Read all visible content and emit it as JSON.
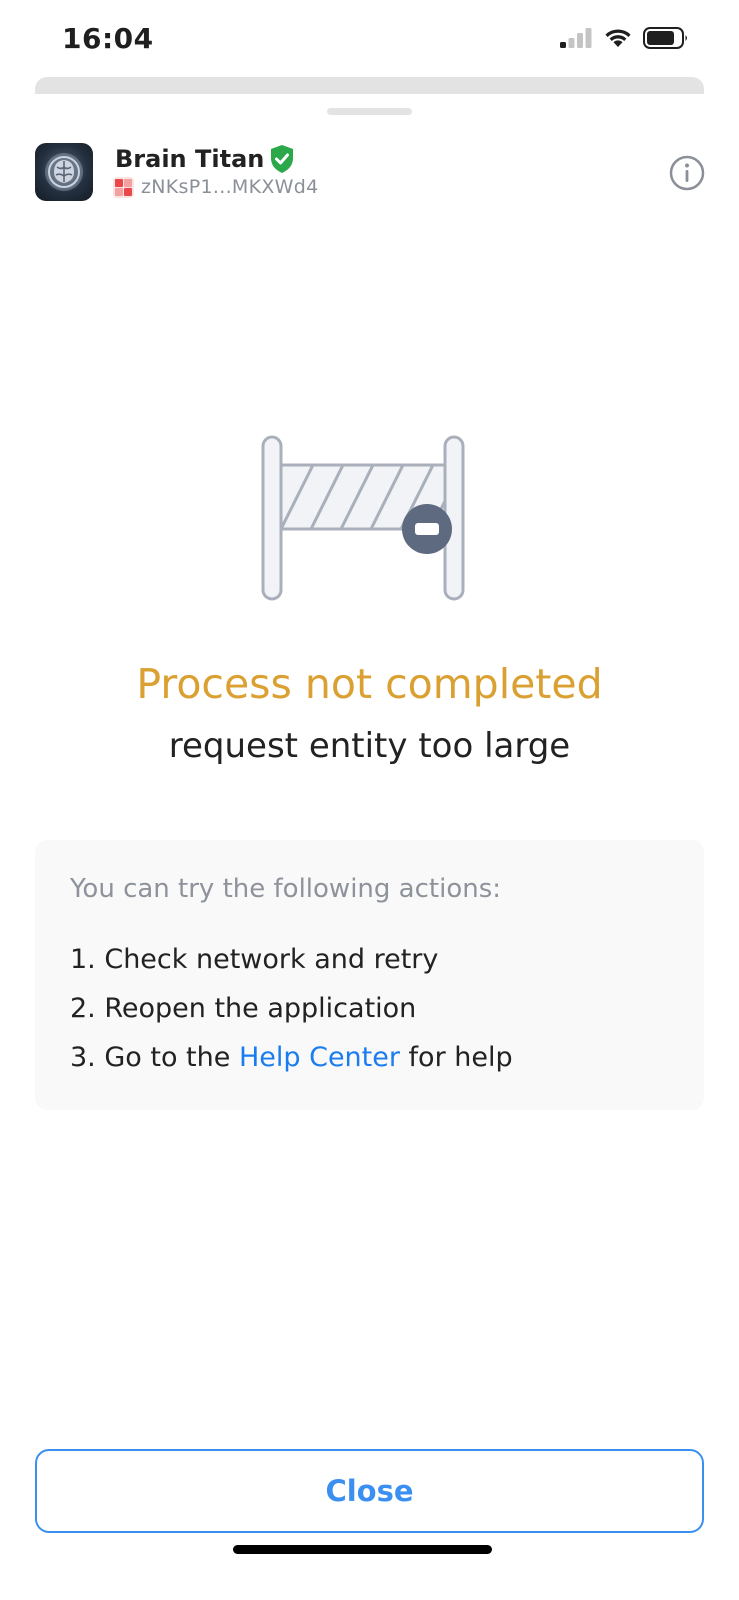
{
  "status_bar": {
    "time": "16:04",
    "icons": [
      "cellular-signal-icon",
      "wifi-icon",
      "battery-icon"
    ]
  },
  "app": {
    "name": "Brain Titan",
    "address": "zNKsP1...MKXWd4",
    "icons": [
      "app-logo-icon",
      "verified-shield-icon",
      "address-avatar-icon",
      "info-icon"
    ]
  },
  "error": {
    "illustration": "barrier-icon",
    "title": "Process not completed",
    "message": "request entity too large"
  },
  "tips": {
    "heading": "You can try the following actions:",
    "items": [
      {
        "text": "1. Check network and retry"
      },
      {
        "text": "2. Reopen the application"
      },
      {
        "prefix": "3. Go to the ",
        "link": "Help Center",
        "suffix": " for help"
      }
    ]
  },
  "actions": {
    "close_label": "Close"
  },
  "colors": {
    "title": "#dba032",
    "link": "#1a7cf0",
    "button_accent": "#3a8ff0",
    "verified": "#2aa84a",
    "illustration_stroke": "#a9b0bc",
    "illustration_badge": "#5d6a80"
  }
}
